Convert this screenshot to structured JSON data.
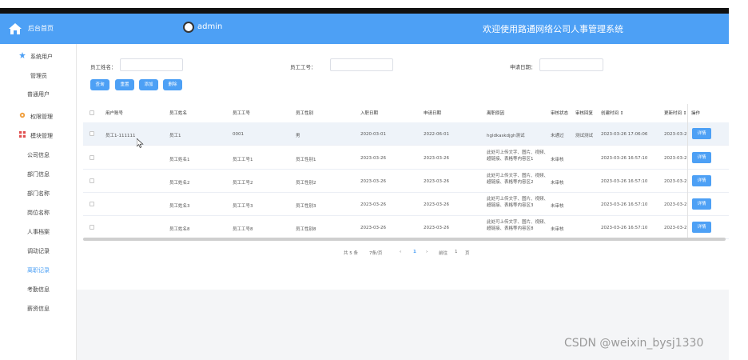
{
  "sidebar": {
    "logo_label": "后台首页",
    "groups": [
      {
        "label": "系统用户",
        "items": [
          "管理员",
          "普通用户"
        ]
      },
      {
        "label": "权限管理",
        "items": []
      },
      {
        "label": "模块管理",
        "items": [
          "公司信息",
          "部门信息",
          "部门名称",
          "岗位名称",
          "人事档案",
          "调动记录",
          "离职记录",
          "考勤信息",
          "薪资信息"
        ]
      }
    ],
    "active_item": "离职记录"
  },
  "header": {
    "user": "admin",
    "welcome": "欢迎使用路通网络公司人事管理系统"
  },
  "filters": {
    "name_label": "员工姓名：",
    "id_label": "员工工号：",
    "date_label": "申请日期："
  },
  "buttons": [
    "查询",
    "重置",
    "添加",
    "删除"
  ],
  "table": {
    "columns": [
      "用户账号",
      "员工姓名",
      "员工工号",
      "员工性别",
      "入职日期",
      "申请日期",
      "离职原因",
      "审核状态",
      "审核回复",
      "创建时间 ↕",
      "更新时间 ↕",
      "操作"
    ],
    "rows": [
      [
        "员工1-111111",
        "员工1",
        "0001",
        "男",
        "2020-03-01",
        "2022-06-01",
        "hgldkaskdjgh测试",
        "未通过",
        "测试测试",
        "2023-03-26 17:06:06",
        "2023-03-26",
        "详情"
      ],
      [
        "",
        "员工姓名1",
        "员工工号1",
        "员工性别1",
        "2023-03-26",
        "2023-03-26",
        "此处可上传文字、图片、视频、超链接、表格等内容区1",
        "未审核",
        "",
        "2023-03-26 16:57:10",
        "2023-03-26",
        "详情"
      ],
      [
        "",
        "员工姓名2",
        "员工工号2",
        "员工性别2",
        "2023-03-26",
        "2023-03-26",
        "此处可上传文字、图片、视频、超链接、表格等内容区2",
        "未审核",
        "",
        "2023-03-26 16:57:10",
        "2023-03-26",
        "详情"
      ],
      [
        "",
        "员工姓名3",
        "员工工号3",
        "员工性别3",
        "2023-03-26",
        "2023-03-26",
        "此处可上传文字、图片、视频、超链接、表格等内容区3",
        "未审核",
        "",
        "2023-03-26 16:57:10",
        "2023-03-26",
        "详情"
      ],
      [
        "",
        "员工姓名8",
        "员工工号8",
        "员工性别8",
        "2023-03-26",
        "2023-03-26",
        "此处可上传文字、图片、视频、超链接、表格等内容区8",
        "未审核",
        "",
        "2023-03-26 16:57:10",
        "2023-03-26",
        "详情"
      ]
    ]
  },
  "pagination": {
    "total": "共 5 条",
    "page_size": "7条/页",
    "prev": "‹",
    "page": "1",
    "next": "›",
    "goto": "前往",
    "goto_value": "1",
    "page_unit": "页"
  },
  "watermark": "CSDN @weixin_bysj1330",
  "colors": {
    "accent": "#4da0f5"
  },
  "icons": [
    "home-icon",
    "star-icon",
    "gear-icon",
    "grid-icon"
  ]
}
